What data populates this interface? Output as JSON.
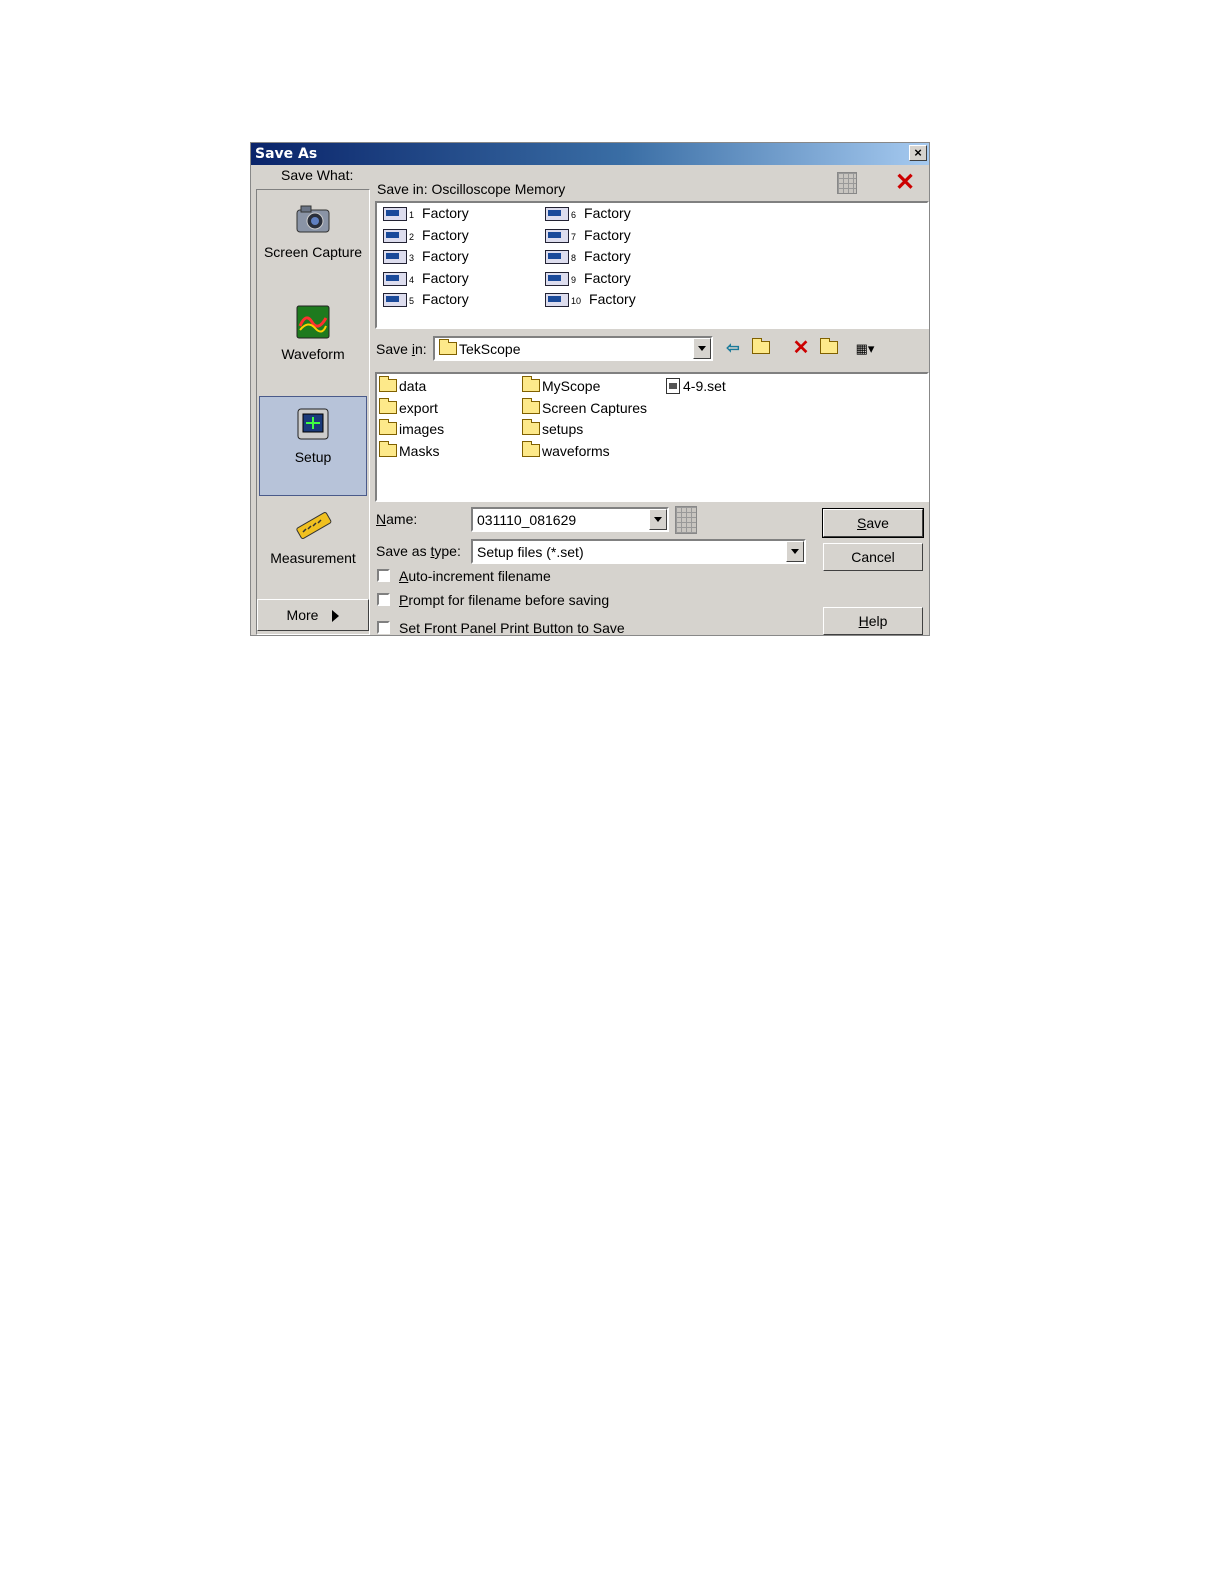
{
  "window": {
    "title": "Save As",
    "close_symbol": "×"
  },
  "save_what": {
    "label": "Save What:",
    "categories": [
      {
        "label": "Screen Capture",
        "icon": "camera-icon"
      },
      {
        "label": "Waveform",
        "icon": "waveform-icon"
      },
      {
        "label": "Setup",
        "icon": "setup-icon",
        "selected": true
      },
      {
        "label": "Measurement",
        "icon": "measurement-icon"
      }
    ],
    "more_label": "More"
  },
  "memory": {
    "label": "Save in: Oscilloscope Memory",
    "items": [
      {
        "num": "1",
        "label": "Factory"
      },
      {
        "num": "2",
        "label": "Factory"
      },
      {
        "num": "3",
        "label": "Factory"
      },
      {
        "num": "4",
        "label": "Factory"
      },
      {
        "num": "5",
        "label": "Factory"
      },
      {
        "num": "6",
        "label": "Factory"
      },
      {
        "num": "7",
        "label": "Factory"
      },
      {
        "num": "8",
        "label": "Factory"
      },
      {
        "num": "9",
        "label": "Factory"
      },
      {
        "num": "10",
        "label": "Factory"
      }
    ]
  },
  "location": {
    "label_pre": "Save ",
    "label_key": "i",
    "label_post": "n:",
    "value": "TekScope"
  },
  "files": {
    "items": [
      {
        "type": "folder",
        "name": "data"
      },
      {
        "type": "folder",
        "name": "export"
      },
      {
        "type": "folder",
        "name": "images"
      },
      {
        "type": "folder",
        "name": "Masks"
      },
      {
        "type": "folder",
        "name": "MyScope"
      },
      {
        "type": "folder",
        "name": "Screen Captures"
      },
      {
        "type": "folder",
        "name": "setups"
      },
      {
        "type": "folder",
        "name": "waveforms"
      },
      {
        "type": "file",
        "name": "4-9.set"
      }
    ]
  },
  "name_field": {
    "label_key": "N",
    "label_rest": "ame:",
    "value": "031110_081629"
  },
  "type_field": {
    "label_pre": "Save as ",
    "label_key": "t",
    "label_post": "ype:",
    "value": "Setup files (*.set)"
  },
  "options": [
    {
      "key": "A",
      "rest": "uto-increment filename",
      "checked": false
    },
    {
      "key": "P",
      "rest": "rompt for filename before saving",
      "checked": false
    },
    {
      "key": "",
      "rest": "Set Front Panel Print Button to Save",
      "checked": false
    }
  ],
  "buttons": {
    "save_key": "S",
    "save_rest": "ave",
    "cancel": "Cancel",
    "help_key": "H",
    "help_rest": "elp"
  },
  "colors": {
    "title_start": "#0a246a",
    "title_end": "#a6caf0",
    "dialog_bg": "#d6d3ce",
    "selected": "#b7c3d9",
    "delete_red": "#cc0000"
  }
}
